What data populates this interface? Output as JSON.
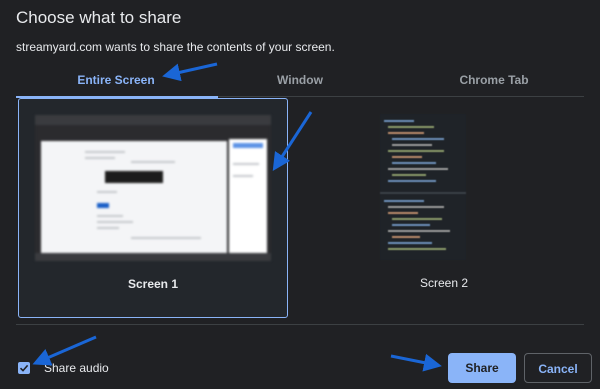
{
  "dialog": {
    "title": "Choose what to share",
    "subtitle": "streamyard.com wants to share the contents of your screen."
  },
  "tabs": [
    {
      "label": "Entire Screen",
      "active": true
    },
    {
      "label": "Window",
      "active": false
    },
    {
      "label": "Chrome Tab",
      "active": false
    }
  ],
  "screens": [
    {
      "label": "Screen 1",
      "selected": true
    },
    {
      "label": "Screen 2",
      "selected": false
    }
  ],
  "footer": {
    "share_audio_label": "Share audio",
    "share_audio_checked": true,
    "share_label": "Share",
    "cancel_label": "Cancel"
  },
  "colors": {
    "background": "#202124",
    "accent": "#8ab4f8",
    "annotation_arrow": "#1a66d6"
  },
  "icons": {
    "checkbox": "check-icon",
    "annotation": "arrow-annotation"
  }
}
